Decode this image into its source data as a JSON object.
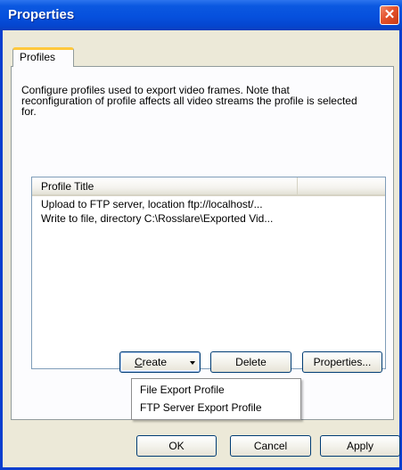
{
  "window": {
    "title": "Properties",
    "close_glyph": "✕",
    "close_icon": "close-icon"
  },
  "tabs": [
    {
      "label": "Profiles",
      "active": true
    }
  ],
  "description": "Configure profiles used to export video frames. Note that reconfiguration of profile affects all video streams the profile is selected for.",
  "profiles": {
    "columns": [
      "Profile Title"
    ],
    "rows": [
      "Upload to FTP server, location ftp://localhost/...",
      "Write to file, directory C:\\Rosslare\\Exported Vid..."
    ]
  },
  "buttons": {
    "create_mnemonic": "C",
    "create_rest": "reate",
    "delete": "Delete",
    "properties": "Properties...",
    "ok": "OK",
    "cancel": "Cancel",
    "apply": "Apply"
  },
  "create_menu": {
    "items": [
      "File Export Profile",
      "FTP Server Export Profile"
    ]
  },
  "colors": {
    "titlebar": "#0650dd",
    "close_button": "#e4512b",
    "dialog_face": "#ece9d8",
    "tab_highlight": "#ffc83c",
    "button_border": "#003c74"
  }
}
